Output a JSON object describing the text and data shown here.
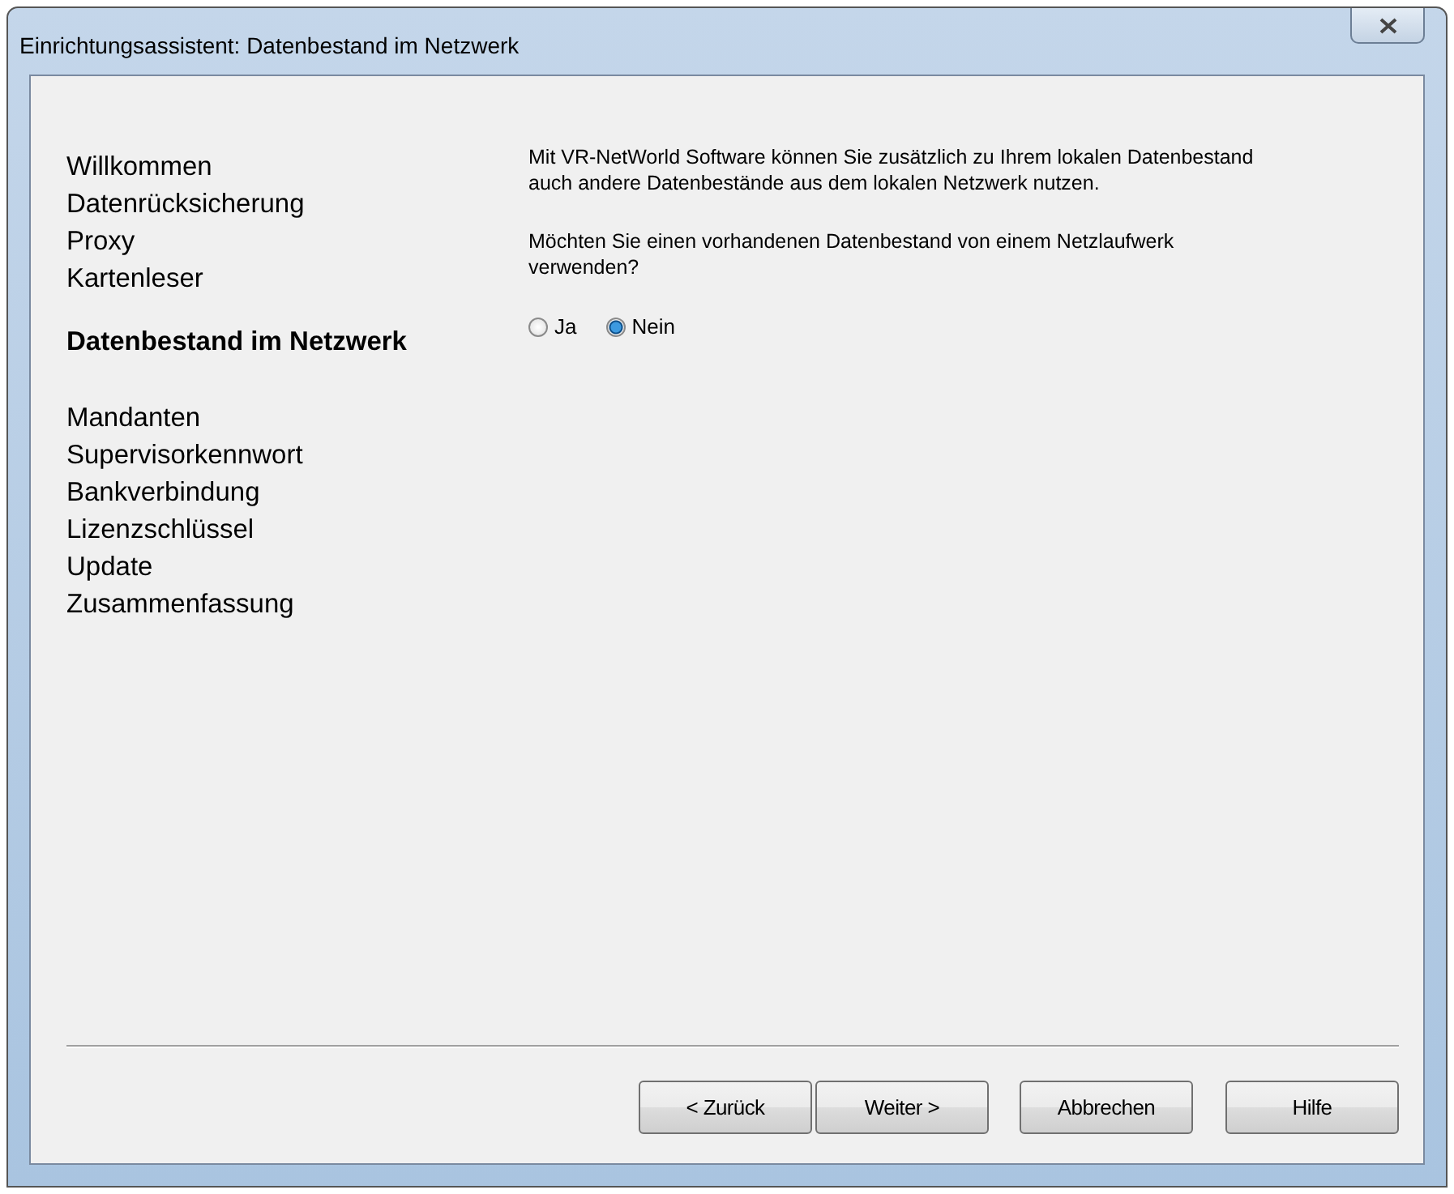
{
  "window": {
    "title": "Einrichtungsassistent: Datenbestand im Netzwerk"
  },
  "steps": [
    {
      "label": "Willkommen",
      "selected": false
    },
    {
      "label": "Datenrücksicherung",
      "selected": false
    },
    {
      "label": "Proxy",
      "selected": false
    },
    {
      "label": "Kartenleser",
      "selected": false
    },
    {
      "label": "Datenbestand im Netzwerk",
      "selected": true
    },
    {
      "label": "Mandanten",
      "selected": false
    },
    {
      "label": "Supervisorkennwort",
      "selected": false
    },
    {
      "label": "Bankverbindung",
      "selected": false
    },
    {
      "label": "Lizenzschlüssel",
      "selected": false
    },
    {
      "label": "Update",
      "selected": false
    },
    {
      "label": "Zusammenfassung",
      "selected": false
    }
  ],
  "intro": "Mit VR-NetWorld Software können Sie zusätzlich zu Ihrem lokalen Datenbestand auch andere Datenbestände aus dem lokalen Netzwerk nutzen.",
  "question": "Möchten Sie einen vorhandenen Datenbestand von einem Netzlaufwerk verwenden?",
  "options": [
    {
      "label": "Ja",
      "selected": false
    },
    {
      "label": "Nein",
      "selected": true
    }
  ],
  "buttons": [
    "< Zurück",
    "Weiter >",
    "Abbrechen",
    "Hilfe"
  ]
}
